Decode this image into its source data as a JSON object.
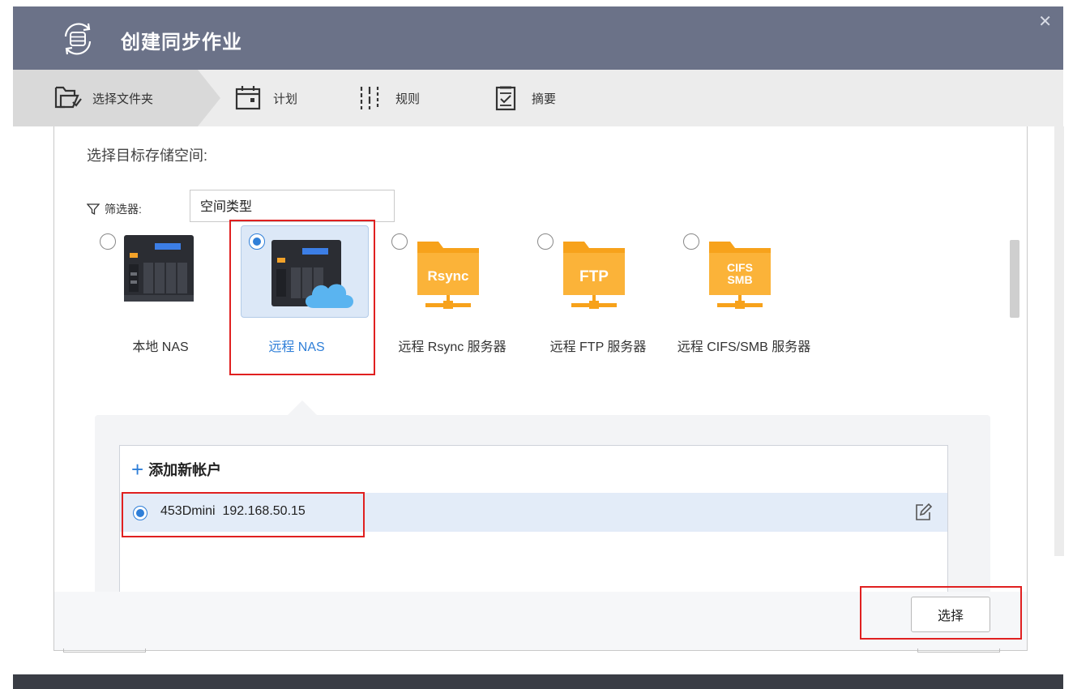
{
  "window": {
    "title": "创建同步作业",
    "close_glyph": "✕",
    "header_bg": "#6b7288"
  },
  "steps": [
    {
      "label": "选择文件夹",
      "icon": "folder-select-icon",
      "active": true
    },
    {
      "label": "计划",
      "icon": "calendar-icon",
      "active": false
    },
    {
      "label": "规则",
      "icon": "sliders-icon",
      "active": false
    },
    {
      "label": "摘要",
      "icon": "clipboard-check-icon",
      "active": false
    }
  ],
  "main": {
    "heading": "选择目标存储空间:",
    "filter": {
      "label": "筛选器:",
      "value": "空间类型"
    },
    "storage_options": [
      {
        "label": "本地 NAS",
        "icon": "nas-device-icon",
        "selected": false
      },
      {
        "label": "远程 NAS",
        "icon": "remote-nas-cloud-icon",
        "selected": true
      },
      {
        "label": "远程 Rsync 服务器",
        "icon": "rsync-folder-icon",
        "icon_text": "Rsync",
        "selected": false
      },
      {
        "label": "远程 FTP 服务器",
        "icon": "ftp-folder-icon",
        "icon_text": "FTP",
        "selected": false
      },
      {
        "label": "远程 CIFS/SMB 服务器",
        "icon": "cifs-smb-folder-icon",
        "icon_text_1": "CIFS",
        "icon_text_2": "SMB",
        "selected": false
      }
    ],
    "accounts": {
      "add_label": "添加新帐户",
      "items": [
        {
          "name": "453Dmini",
          "ip": "192.168.50.15",
          "selected": true
        }
      ]
    },
    "select_button": "选择"
  },
  "colors": {
    "accent": "#2f7fd8",
    "folder_orange": "#f7a21b",
    "highlight_red": "#e02020"
  }
}
